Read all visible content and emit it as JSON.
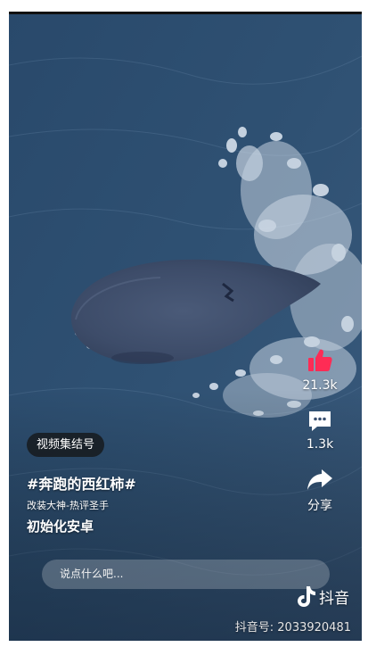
{
  "video": {
    "description_tag": "whale-swimming-ocean-aerial"
  },
  "actions": {
    "like_count": "21.3k",
    "comment_count": "1.3k",
    "share_label": "分享",
    "like_color": "#fe2c55"
  },
  "info": {
    "collection_label": "视频集结号",
    "hashtag": "#奔跑的西红柿#",
    "subline": "改装大神-热评圣手",
    "caption": "初始化安卓"
  },
  "comment": {
    "placeholder": "说点什么吧..."
  },
  "watermark": {
    "app_name": "抖音",
    "id_text": "抖音号: 2033920481"
  }
}
